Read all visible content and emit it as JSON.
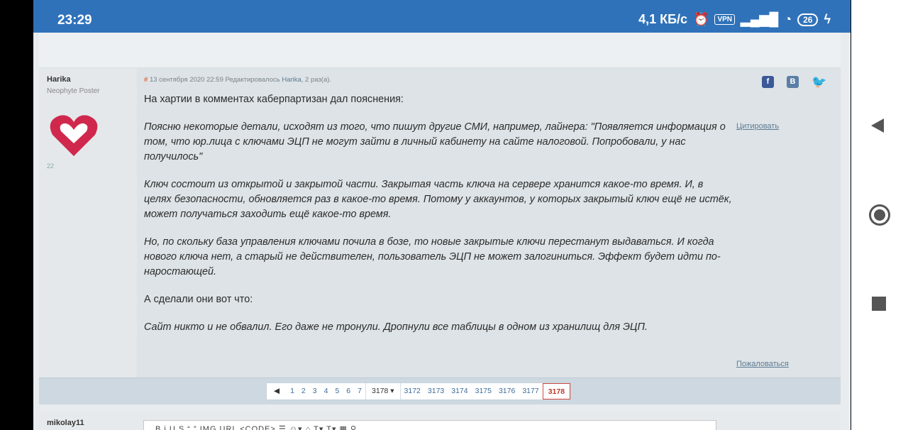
{
  "statusbar": {
    "time": "23:29",
    "speed": "4,1 КБ/с",
    "vpn": "VPN",
    "battery": "26",
    "icons": [
      "alarm-icon",
      "vpn-icon",
      "signal-icon",
      "wifi-icon",
      "battery-icon",
      "charging-icon"
    ]
  },
  "post": {
    "author": {
      "name": "Harika",
      "rank": "Neophyte Poster",
      "post_count": "22"
    },
    "meta": {
      "hash": "#",
      "date": "13 сентября 2020 22:59",
      "edited_prefix": "Редактировалось",
      "editor": "Harika",
      "edit_suffix": ", 2 раз(а)."
    },
    "paragraphs": [
      {
        "text": "На хартии в комментах каберпартизан дал пояснения:",
        "italic": false
      },
      {
        "text": "Поясню некоторые детали, исходят из того, что пишут другие СМИ, например, лайнера: \"Появляется информация о том, что юр.лица с ключами ЭЦП не могут зайти в личный кабинету на сайте налоговой. Попробовали, у нас получилось\"",
        "italic": true
      },
      {
        "text": "Ключ состоит из открытой и закрытой части. Закрытая часть ключа на сервере хранится какое-то время. И, в целях безопасности, обновляется раз в какое-то время. Потому у аккаунтов, у которых закрытый ключ ещё не истёк, может получаться заходить ещё какое-то время.",
        "italic": true
      },
      {
        "text": "Но, по скольку база управления ключами почила в бозе, то новые закрытые ключи перестанут выдаваться. И когда нового ключа нет, а старый не действителен, пользователь ЭЦП не может залогиниться. Эффект будет идти по-наростающей.",
        "italic": true
      },
      {
        "text": "А сделали они вот что:",
        "italic": false
      },
      {
        "text": "Сайт никто и не обвалил. Его даже не тронули. Дропнули все таблицы в одном из хранилищ для ЭЦП.",
        "italic": true
      }
    ],
    "quote_label": "Цитировать",
    "report_label": "Пожаловаться",
    "share": {
      "facebook": "f",
      "vk": "B",
      "twitter": "🐦"
    }
  },
  "pagination": {
    "prev": "◀",
    "pages_start": [
      "1",
      "2",
      "3",
      "4",
      "5",
      "6",
      "7"
    ],
    "dropdown": "3178 ▾",
    "pages_end": [
      "3172",
      "3173",
      "3174",
      "3175",
      "3176",
      "3177"
    ],
    "current": "3178"
  },
  "next_post": {
    "author": "mikolay11",
    "toolbar": "B  i  U  S  “ ”  IMG  URL  <CODE>  ☰  ☺▾  ⌂  T▾  T▾  ▦  ⚲"
  },
  "colors": {
    "statusbar": "#2f72ba",
    "accent": "#d04a40",
    "link": "#3d6c9a"
  }
}
